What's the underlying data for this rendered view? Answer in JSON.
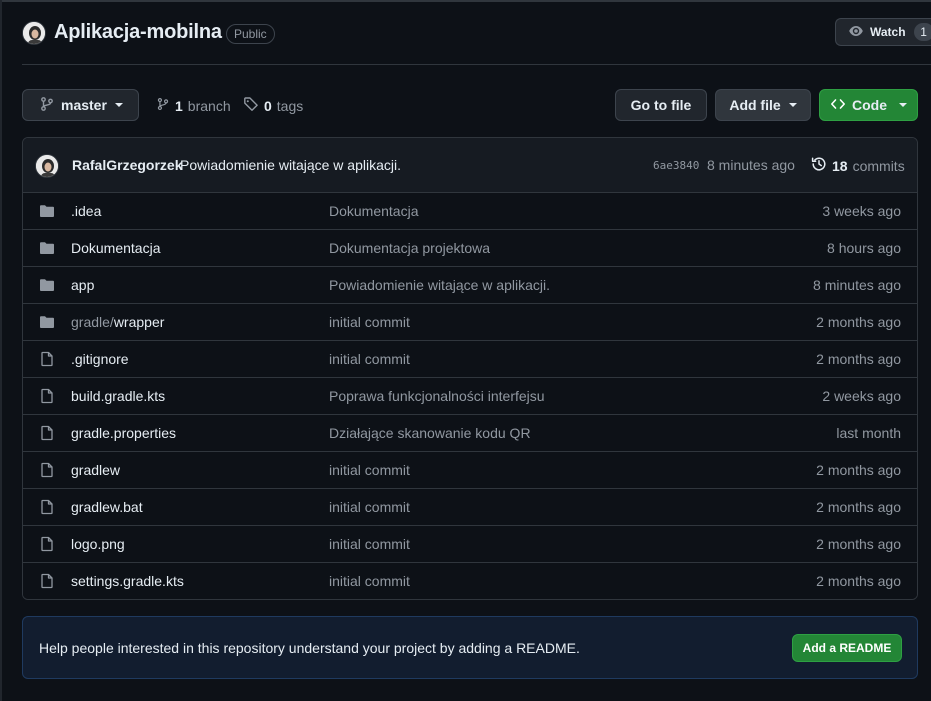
{
  "repo": {
    "name": "Aplikacja-mobilna",
    "visibility": "Public",
    "watch_label": "Watch",
    "watch_count": "1"
  },
  "toolbar": {
    "branch": "master",
    "branch_count": "1",
    "branch_label": "branch",
    "tag_count": "0",
    "tag_label": "tags",
    "goto_file": "Go to file",
    "add_file": "Add file",
    "code": "Code"
  },
  "commit": {
    "author": "RafalGrzegorzek",
    "message": "Powiadomienie witające w aplikacji.",
    "hash": "6ae3840",
    "time": "8 minutes ago",
    "count": "18",
    "count_label": "commits"
  },
  "files": [
    {
      "type": "folder",
      "prefix": "",
      "name": ".idea",
      "commit": "Dokumentacja",
      "age": "3 weeks ago"
    },
    {
      "type": "folder",
      "prefix": "",
      "name": "Dokumentacja",
      "commit": "Dokumentacja projektowa",
      "age": "8 hours ago"
    },
    {
      "type": "folder",
      "prefix": "",
      "name": "app",
      "commit": "Powiadomienie witające w aplikacji.",
      "age": "8 minutes ago"
    },
    {
      "type": "folder",
      "prefix": "gradle/",
      "name": "wrapper",
      "commit": "initial commit",
      "age": "2 months ago"
    },
    {
      "type": "file",
      "prefix": "",
      "name": ".gitignore",
      "commit": "initial commit",
      "age": "2 months ago"
    },
    {
      "type": "file",
      "prefix": "",
      "name": "build.gradle.kts",
      "commit": "Poprawa funkcjonalności interfejsu",
      "age": "2 weeks ago"
    },
    {
      "type": "file",
      "prefix": "",
      "name": "gradle.properties",
      "commit": "Działające skanowanie kodu QR",
      "age": "last month"
    },
    {
      "type": "file",
      "prefix": "",
      "name": "gradlew",
      "commit": "initial commit",
      "age": "2 months ago"
    },
    {
      "type": "file",
      "prefix": "",
      "name": "gradlew.bat",
      "commit": "initial commit",
      "age": "2 months ago"
    },
    {
      "type": "file",
      "prefix": "",
      "name": "logo.png",
      "commit": "initial commit",
      "age": "2 months ago"
    },
    {
      "type": "file",
      "prefix": "",
      "name": "settings.gradle.kts",
      "commit": "initial commit",
      "age": "2 months ago"
    }
  ],
  "readme": {
    "message": "Help people interested in this repository understand your project by adding a README.",
    "button": "Add a README"
  },
  "colors": {
    "background": "#0d1117",
    "primary_green": "#238636",
    "muted_text": "#9198a1",
    "border": "#30363d"
  }
}
